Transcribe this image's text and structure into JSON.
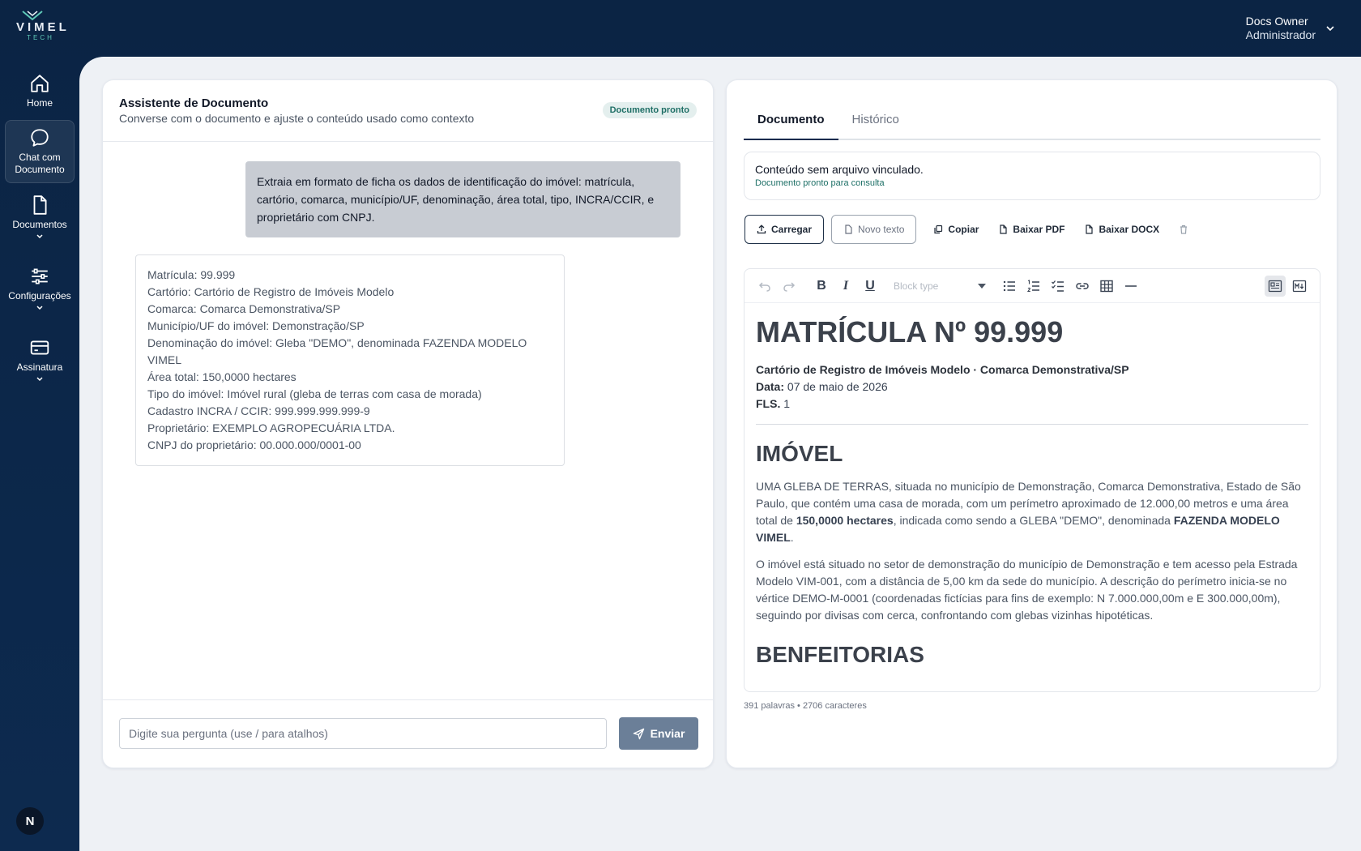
{
  "brand": {
    "name": "VIMEL",
    "tagline": "TECH"
  },
  "user": {
    "name": "Docs Owner",
    "role": "Administrador"
  },
  "sidebar": {
    "items": [
      {
        "label": "Home",
        "icon": "home-icon"
      },
      {
        "label": "Chat com Documento",
        "icon": "chat-icon"
      },
      {
        "label": "Documentos",
        "icon": "document-icon"
      },
      {
        "label": "Configurações",
        "icon": "sliders-icon"
      },
      {
        "label": "Assinatura",
        "icon": "credit-card-icon"
      }
    ],
    "bottom_badge": "N"
  },
  "chat": {
    "title": "Assistente de Documento",
    "subtitle": "Converse com o documento e ajuste o conteúdo usado como contexto",
    "status_badge": "Documento pronto",
    "user_message": "Extraia em formato de ficha os dados de identificação do imóvel: matrícula, cartório, comarca, município/UF, denominação, área total, tipo, INCRA/CCIR, e proprietário com CNPJ.",
    "bot_lines": [
      "Matrícula: 99.999",
      "Cartório: Cartório de Registro de Imóveis Modelo",
      "Comarca: Comarca Demonstrativa/SP",
      "Município/UF do imóvel: Demonstração/SP",
      "Denominação do imóvel: Gleba \"DEMO\", denominada FAZENDA MODELO VIMEL",
      "Área total: 150,0000 hectares",
      "Tipo do imóvel: Imóvel rural (gleba de terras com casa de morada)",
      "Cadastro INCRA / CCIR: 999.999.999.999-9",
      "Proprietário: EXEMPLO AGROPECUÁRIA LTDA.",
      "CNPJ do proprietário: 00.000.000/0001-00"
    ],
    "input_placeholder": "Digite sua pergunta (use / para atalhos)",
    "send_label": "Enviar"
  },
  "document": {
    "tabs": [
      {
        "label": "Documento",
        "active": true
      },
      {
        "label": "Histórico",
        "active": false
      }
    ],
    "info_main": "Conteúdo sem arquivo vinculado.",
    "info_sub": "Documento pronto para consulta",
    "actions": {
      "upload": "Carregar",
      "new_text": "Novo texto",
      "copy": "Copiar",
      "pdf": "Baixar PDF",
      "docx": "Baixar DOCX"
    },
    "editor": {
      "block_type_placeholder": "Block type",
      "heading1": "MATRÍCULA Nº 99.999",
      "meta_line1": "Cartório de Registro de Imóveis Modelo · Comarca Demonstrativa/SP",
      "meta_data_label": "Data:",
      "meta_data_value": " 07 de maio de 2026",
      "meta_fls_label": "FLS.",
      "meta_fls_value": " 1",
      "heading2_imovel": "IMÓVEL",
      "p1_a": "UMA GLEBA DE TERRAS, situada no município de Demonstração, Comarca Demonstrativa, Estado de São Paulo, que contém uma casa de morada, com um perímetro aproximado de 12.000,00 metros e uma área total de ",
      "p1_b": "150,0000 hectares",
      "p1_c": ", indicada como sendo a GLEBA \"DEMO\", denominada ",
      "p1_d": "FAZENDA MODELO VIMEL",
      "p1_e": ".",
      "p2": "O imóvel está situado no setor de demonstração do município de Demonstração e tem acesso pela Estrada Modelo VIM-001, com a distância de 5,00 km da sede do município. A descrição do perímetro inicia-se no vértice DEMO-M-0001 (coordenadas fictícias para fins de exemplo: N 7.000.000,00m e E 300.000,00m), seguindo por divisas com cerca, confrontando com glebas vizinhas hipotéticas.",
      "heading2_benfeitorias": "BENFEITORIAS"
    },
    "word_count": "391 palavras • 2706 caracteres"
  }
}
